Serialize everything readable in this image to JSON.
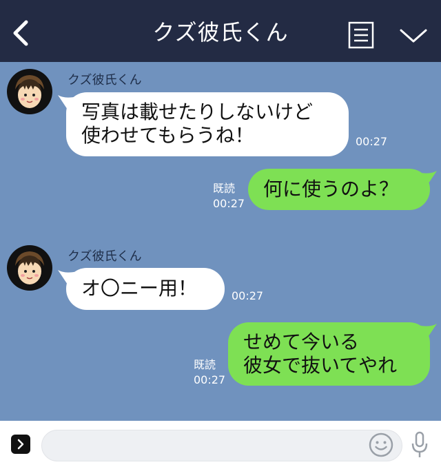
{
  "header": {
    "title": "クズ彼氏くん",
    "back_icon": "chevron-left-icon",
    "menu_icon": "menu-list-icon",
    "collapse_icon": "chevron-down-icon"
  },
  "messages": [
    {
      "direction": "incoming",
      "sender": "クズ彼氏くん",
      "text": "写真は載せたりしないけど\n使わせてもらうね！",
      "time": "00:27"
    },
    {
      "direction": "outgoing",
      "read": "既読",
      "text": "何に使うのよ？",
      "time": "00:27"
    },
    {
      "direction": "incoming",
      "sender": "クズ彼氏くん",
      "text": "オ〇ニー用！",
      "time": "00:27"
    },
    {
      "direction": "outgoing",
      "read": "既読",
      "text": "せめて今いる\n彼女で抜いてやれ",
      "time": "00:27"
    }
  ],
  "footer": {
    "input_placeholder": "",
    "expand_icon": "chevron-right-icon",
    "emoji_icon": "smile-icon",
    "mic_icon": "microphone-icon"
  },
  "colors": {
    "header_bg": "#232b44",
    "chat_bg": "#7092be",
    "incoming_bubble": "#ffffff",
    "outgoing_bubble": "#7ee054"
  }
}
